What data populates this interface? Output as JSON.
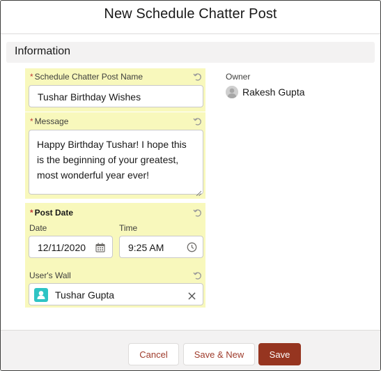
{
  "modal": {
    "title": "New Schedule Chatter Post"
  },
  "section": {
    "title": "Information"
  },
  "fields": {
    "post_name": {
      "label": "Schedule Chatter Post Name",
      "required": "*",
      "value": "Tushar Birthday Wishes"
    },
    "message": {
      "label": "Message",
      "required": "*",
      "value": "Happy Birthday Tushar! I hope this is the beginning of your greatest, most wonderful year ever!"
    },
    "post_date": {
      "label": "Post Date",
      "required": "*",
      "date_label": "Date",
      "date_value": "12/11/2020",
      "time_label": "Time",
      "time_value": "9:25 AM"
    },
    "users_wall": {
      "label": "User's Wall",
      "value": "Tushar Gupta"
    }
  },
  "owner": {
    "label": "Owner",
    "name": "Rakesh Gupta"
  },
  "footer": {
    "cancel": "Cancel",
    "save_new": "Save & New",
    "save": "Save"
  },
  "colors": {
    "highlight": "#f8f8bc",
    "brand_button": "#963520",
    "required": "#c23934",
    "user_icon": "#2ec4c4"
  },
  "icons": [
    "undo-icon",
    "calendar-icon",
    "clock-icon",
    "user-icon",
    "clear-icon",
    "avatar"
  ]
}
